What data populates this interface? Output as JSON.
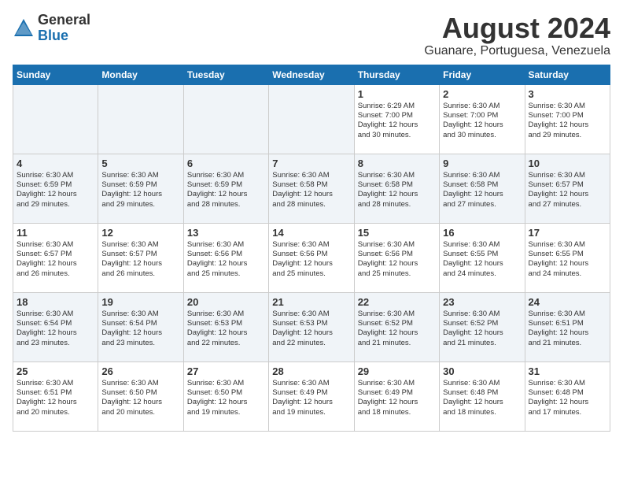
{
  "header": {
    "logo_line1": "General",
    "logo_line2": "Blue",
    "title": "August 2024",
    "subtitle": "Guanare, Portuguesa, Venezuela"
  },
  "days_of_week": [
    "Sunday",
    "Monday",
    "Tuesday",
    "Wednesday",
    "Thursday",
    "Friday",
    "Saturday"
  ],
  "weeks": [
    [
      {
        "day": "",
        "info": ""
      },
      {
        "day": "",
        "info": ""
      },
      {
        "day": "",
        "info": ""
      },
      {
        "day": "",
        "info": ""
      },
      {
        "day": "1",
        "info": "Sunrise: 6:29 AM\nSunset: 7:00 PM\nDaylight: 12 hours\nand 30 minutes."
      },
      {
        "day": "2",
        "info": "Sunrise: 6:30 AM\nSunset: 7:00 PM\nDaylight: 12 hours\nand 30 minutes."
      },
      {
        "day": "3",
        "info": "Sunrise: 6:30 AM\nSunset: 7:00 PM\nDaylight: 12 hours\nand 29 minutes."
      }
    ],
    [
      {
        "day": "4",
        "info": "Sunrise: 6:30 AM\nSunset: 6:59 PM\nDaylight: 12 hours\nand 29 minutes."
      },
      {
        "day": "5",
        "info": "Sunrise: 6:30 AM\nSunset: 6:59 PM\nDaylight: 12 hours\nand 29 minutes."
      },
      {
        "day": "6",
        "info": "Sunrise: 6:30 AM\nSunset: 6:59 PM\nDaylight: 12 hours\nand 28 minutes."
      },
      {
        "day": "7",
        "info": "Sunrise: 6:30 AM\nSunset: 6:58 PM\nDaylight: 12 hours\nand 28 minutes."
      },
      {
        "day": "8",
        "info": "Sunrise: 6:30 AM\nSunset: 6:58 PM\nDaylight: 12 hours\nand 28 minutes."
      },
      {
        "day": "9",
        "info": "Sunrise: 6:30 AM\nSunset: 6:58 PM\nDaylight: 12 hours\nand 27 minutes."
      },
      {
        "day": "10",
        "info": "Sunrise: 6:30 AM\nSunset: 6:57 PM\nDaylight: 12 hours\nand 27 minutes."
      }
    ],
    [
      {
        "day": "11",
        "info": "Sunrise: 6:30 AM\nSunset: 6:57 PM\nDaylight: 12 hours\nand 26 minutes."
      },
      {
        "day": "12",
        "info": "Sunrise: 6:30 AM\nSunset: 6:57 PM\nDaylight: 12 hours\nand 26 minutes."
      },
      {
        "day": "13",
        "info": "Sunrise: 6:30 AM\nSunset: 6:56 PM\nDaylight: 12 hours\nand 25 minutes."
      },
      {
        "day": "14",
        "info": "Sunrise: 6:30 AM\nSunset: 6:56 PM\nDaylight: 12 hours\nand 25 minutes."
      },
      {
        "day": "15",
        "info": "Sunrise: 6:30 AM\nSunset: 6:56 PM\nDaylight: 12 hours\nand 25 minutes."
      },
      {
        "day": "16",
        "info": "Sunrise: 6:30 AM\nSunset: 6:55 PM\nDaylight: 12 hours\nand 24 minutes."
      },
      {
        "day": "17",
        "info": "Sunrise: 6:30 AM\nSunset: 6:55 PM\nDaylight: 12 hours\nand 24 minutes."
      }
    ],
    [
      {
        "day": "18",
        "info": "Sunrise: 6:30 AM\nSunset: 6:54 PM\nDaylight: 12 hours\nand 23 minutes."
      },
      {
        "day": "19",
        "info": "Sunrise: 6:30 AM\nSunset: 6:54 PM\nDaylight: 12 hours\nand 23 minutes."
      },
      {
        "day": "20",
        "info": "Sunrise: 6:30 AM\nSunset: 6:53 PM\nDaylight: 12 hours\nand 22 minutes."
      },
      {
        "day": "21",
        "info": "Sunrise: 6:30 AM\nSunset: 6:53 PM\nDaylight: 12 hours\nand 22 minutes."
      },
      {
        "day": "22",
        "info": "Sunrise: 6:30 AM\nSunset: 6:52 PM\nDaylight: 12 hours\nand 21 minutes."
      },
      {
        "day": "23",
        "info": "Sunrise: 6:30 AM\nSunset: 6:52 PM\nDaylight: 12 hours\nand 21 minutes."
      },
      {
        "day": "24",
        "info": "Sunrise: 6:30 AM\nSunset: 6:51 PM\nDaylight: 12 hours\nand 21 minutes."
      }
    ],
    [
      {
        "day": "25",
        "info": "Sunrise: 6:30 AM\nSunset: 6:51 PM\nDaylight: 12 hours\nand 20 minutes."
      },
      {
        "day": "26",
        "info": "Sunrise: 6:30 AM\nSunset: 6:50 PM\nDaylight: 12 hours\nand 20 minutes."
      },
      {
        "day": "27",
        "info": "Sunrise: 6:30 AM\nSunset: 6:50 PM\nDaylight: 12 hours\nand 19 minutes."
      },
      {
        "day": "28",
        "info": "Sunrise: 6:30 AM\nSunset: 6:49 PM\nDaylight: 12 hours\nand 19 minutes."
      },
      {
        "day": "29",
        "info": "Sunrise: 6:30 AM\nSunset: 6:49 PM\nDaylight: 12 hours\nand 18 minutes."
      },
      {
        "day": "30",
        "info": "Sunrise: 6:30 AM\nSunset: 6:48 PM\nDaylight: 12 hours\nand 18 minutes."
      },
      {
        "day": "31",
        "info": "Sunrise: 6:30 AM\nSunset: 6:48 PM\nDaylight: 12 hours\nand 17 minutes."
      }
    ]
  ]
}
